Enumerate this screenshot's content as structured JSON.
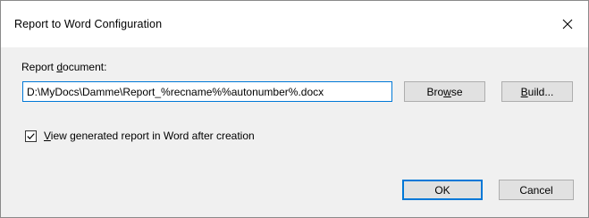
{
  "window": {
    "title": "Report to Word Configuration",
    "close_icon": "close-icon"
  },
  "report_document": {
    "label_prefix": "Report ",
    "label_mnemonic": "d",
    "label_suffix": "ocument:",
    "value": "D:\\MyDocs\\Damme\\Report_%recname%%autonumber%.docx"
  },
  "buttons": {
    "browse_prefix": "Bro",
    "browse_mnemonic": "w",
    "browse_suffix": "se",
    "build_mnemonic": "B",
    "build_suffix": "uild...",
    "ok": "OK",
    "cancel": "Cancel"
  },
  "view_option": {
    "checked": true,
    "label_mnemonic": "V",
    "label_suffix": "iew generated report in Word after creation"
  },
  "colors": {
    "focus_border": "#0078d7",
    "dialog_background": "#f0f0f0",
    "button_face": "#e1e1e1"
  }
}
